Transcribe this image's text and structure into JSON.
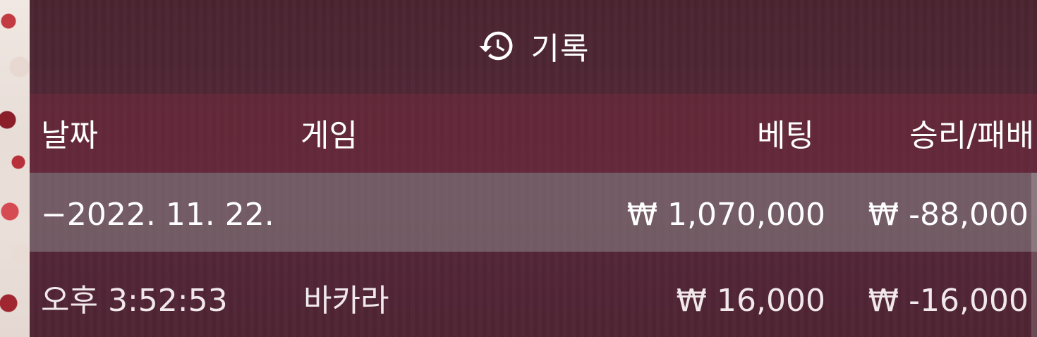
{
  "header": {
    "title": "기록",
    "icon": "history-icon"
  },
  "columns": {
    "date": "날짜",
    "game": "게임",
    "bet": "베팅",
    "result": "승리/패배"
  },
  "rows": [
    {
      "type": "date-group",
      "date": "−2022. 11. 22.",
      "bet": "₩ 1,070,000",
      "result": "₩ -88,000"
    },
    {
      "type": "entry",
      "time": "오후 3:52:53",
      "game": "바카라",
      "bet": "₩ 16,000",
      "result": "₩ -16,000"
    }
  ],
  "colors": {
    "panel_bg": "#4a2530",
    "header_row_bg": "#7a2d3e",
    "selected_row_bg": "#8c8789",
    "text": "#ffffff"
  }
}
